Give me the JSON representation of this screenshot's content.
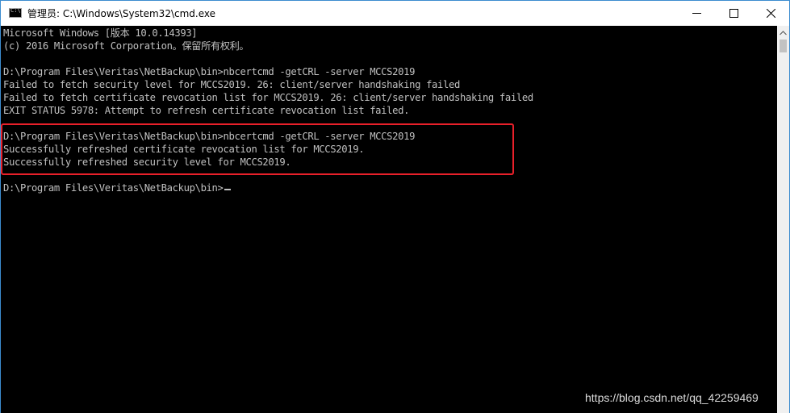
{
  "window": {
    "title": "管理员: C:\\Windows\\System32\\cmd.exe",
    "icon": "cmd-console-icon",
    "controls": {
      "minimize": "minimize-icon",
      "maximize": "maximize-icon",
      "close": "close-icon"
    }
  },
  "console": {
    "lines": [
      "Microsoft Windows [版本 10.0.14393]",
      "(c) 2016 Microsoft Corporation。保留所有权利。",
      "",
      "D:\\Program Files\\Veritas\\NetBackup\\bin>nbcertcmd -getCRL -server MCCS2019",
      "Failed to fetch security level for MCCS2019. 26: client/server handshaking failed",
      "Failed to fetch certificate revocation list for MCCS2019. 26: client/server handshaking failed",
      "EXIT STATUS 5978: Attempt to refresh certificate revocation list failed.",
      "",
      "D:\\Program Files\\Veritas\\NetBackup\\bin>nbcertcmd -getCRL -server MCCS2019",
      "Successfully refreshed certificate revocation list for MCCS2019.",
      "Successfully refreshed security level for MCCS2019.",
      "",
      "D:\\Program Files\\Veritas\\NetBackup\\bin>"
    ],
    "text_color": "#c0c0c0",
    "background": "#000000"
  },
  "annotation": {
    "highlight_color": "#e8202a"
  },
  "watermark": {
    "text": "https://blog.csdn.net/qq_42259469"
  }
}
